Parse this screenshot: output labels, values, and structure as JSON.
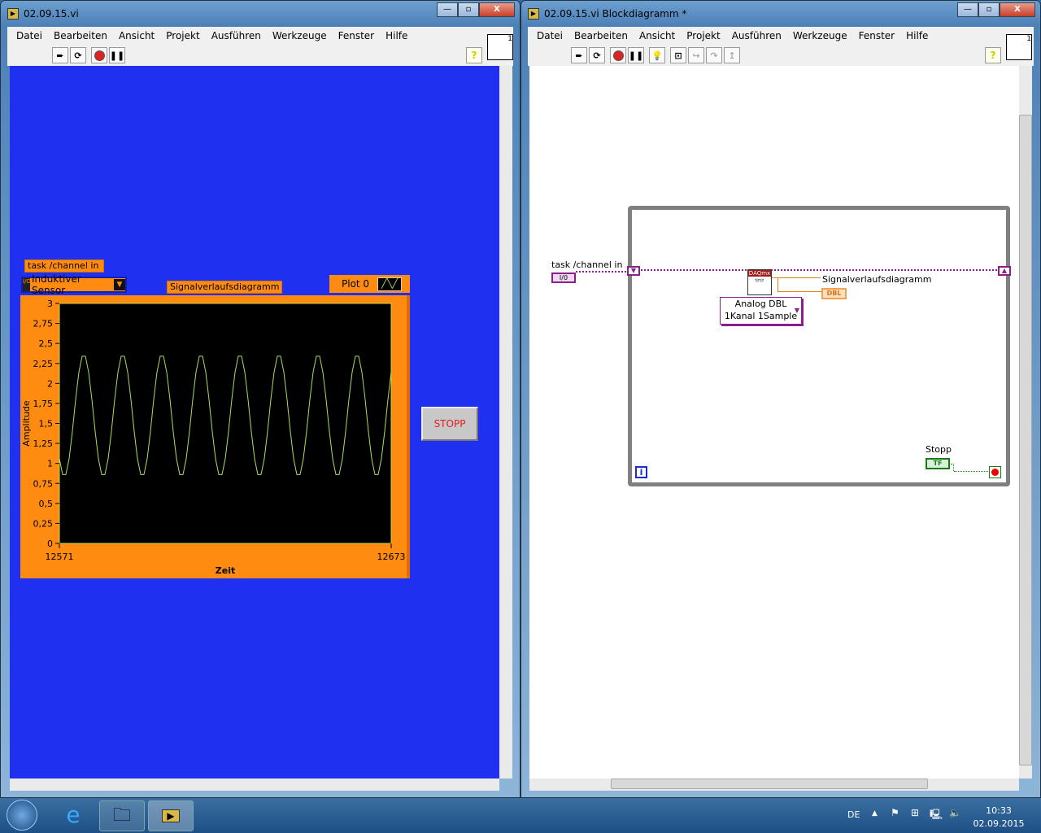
{
  "front_panel": {
    "title": "02.09.15.vi",
    "menu": [
      "Datei",
      "Bearbeiten",
      "Ansicht",
      "Projekt",
      "Ausführen",
      "Werkzeuge",
      "Fenster",
      "Hilfe"
    ],
    "task_label": "task /channel in",
    "task_value": "Induktiver Sensor",
    "chart_label": "Signalverlaufsdiagramm",
    "legend_label": "Plot 0",
    "stop_label": "STOPP",
    "bg_color": "#2030f0",
    "accent": "#ff8c10"
  },
  "block_diagram": {
    "title": "02.09.15.vi Blockdiagramm *",
    "menu": [
      "Datei",
      "Bearbeiten",
      "Ansicht",
      "Projekt",
      "Ausführen",
      "Werkzeuge",
      "Fenster",
      "Hilfe"
    ],
    "task_label": "task /channel in",
    "io_terminal": "I/0",
    "daqmx_label": "DAQmx",
    "read_mode_line1": "Analog DBL",
    "read_mode_line2": "1Kanal 1Sample",
    "chart_terminal_label": "Signalverlaufsdiagramm",
    "chart_terminal_type": "DBL",
    "stop_label": "Stopp",
    "stop_terminal_type": "TF",
    "iteration_label": "i"
  },
  "taskbar": {
    "language": "DE",
    "time": "10:33",
    "date": "02.09.2015"
  },
  "chart_data": {
    "type": "line",
    "title": "Signalverlaufsdiagramm",
    "xlabel": "Zeit",
    "ylabel": "Amplitude",
    "xlim": [
      12571,
      12673
    ],
    "ylim": [
      0,
      3
    ],
    "yticks": [
      "0",
      "0,25",
      "0,5",
      "0,75",
      "1",
      "1,25",
      "1,5",
      "1,75",
      "2",
      "2,25",
      "2,5",
      "2,75",
      "3"
    ],
    "xticks": [
      "12571",
      "12673"
    ],
    "legend": "Plot 0",
    "series": [
      {
        "name": "Plot 0",
        "color": "#a8e060",
        "x_start": 12571,
        "x_step": 1,
        "values": [
          1.06,
          0.86,
          0.86,
          1.06,
          1.4,
          1.8,
          2.14,
          2.34,
          2.34,
          2.14,
          1.8,
          1.4,
          1.06,
          0.86,
          0.86,
          1.06,
          1.4,
          1.8,
          2.14,
          2.34,
          2.34,
          2.14,
          1.8,
          1.4,
          1.06,
          0.86,
          0.86,
          1.06,
          1.4,
          1.8,
          2.14,
          2.34,
          2.34,
          2.14,
          1.8,
          1.4,
          1.06,
          0.86,
          0.86,
          1.06,
          1.4,
          1.8,
          2.14,
          2.34,
          2.34,
          2.14,
          1.8,
          1.4,
          1.06,
          0.86,
          0.86,
          1.06,
          1.4,
          1.8,
          2.14,
          2.34,
          2.34,
          2.14,
          1.8,
          1.4,
          1.06,
          0.86,
          0.86,
          1.06,
          1.4,
          1.8,
          2.14,
          2.34,
          2.34,
          2.14,
          1.8,
          1.4,
          1.06,
          0.86,
          0.86,
          1.06,
          1.4,
          1.8,
          2.14,
          2.34,
          2.34,
          2.14,
          1.8,
          1.4,
          1.06,
          0.86,
          0.86,
          1.06,
          1.4,
          1.8,
          2.14,
          2.34,
          2.34,
          2.14,
          1.8,
          1.4,
          1.06,
          0.86,
          0.86,
          1.06,
          1.4,
          1.8,
          2.14
        ]
      }
    ]
  }
}
